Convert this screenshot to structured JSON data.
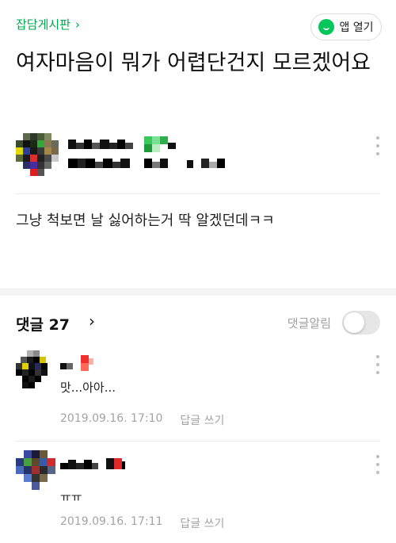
{
  "board": {
    "name": "잡담게시판",
    "chevron": "›",
    "icon": "chevron-right-icon"
  },
  "app_button": {
    "label": "앱 열기",
    "icon": "naver-app-icon",
    "accent": "#03c75a"
  },
  "post": {
    "title": "여자마음이 뭐가 어렵단건지 모르겠어요",
    "body": "그냥 척보면 날 싫어하는거 딱 알겠던데ㅋㅋ"
  },
  "comments_header": {
    "label": "댓글 27",
    "chevron": "›",
    "alarm_label": "댓글알림",
    "alarm_on": false
  },
  "comments": [
    {
      "text": "맛...아아...",
      "timestamp": "2019.09.16. 17:10",
      "reply_label": "답글 쓰기"
    },
    {
      "text": "ㅠㅠ",
      "timestamp": "2019.09.16. 17:11",
      "reply_label": "답글 쓰기"
    }
  ],
  "colors": {
    "accent": "#03a94f",
    "muted": "#a3a3a3",
    "divider": "#ebebeb"
  }
}
